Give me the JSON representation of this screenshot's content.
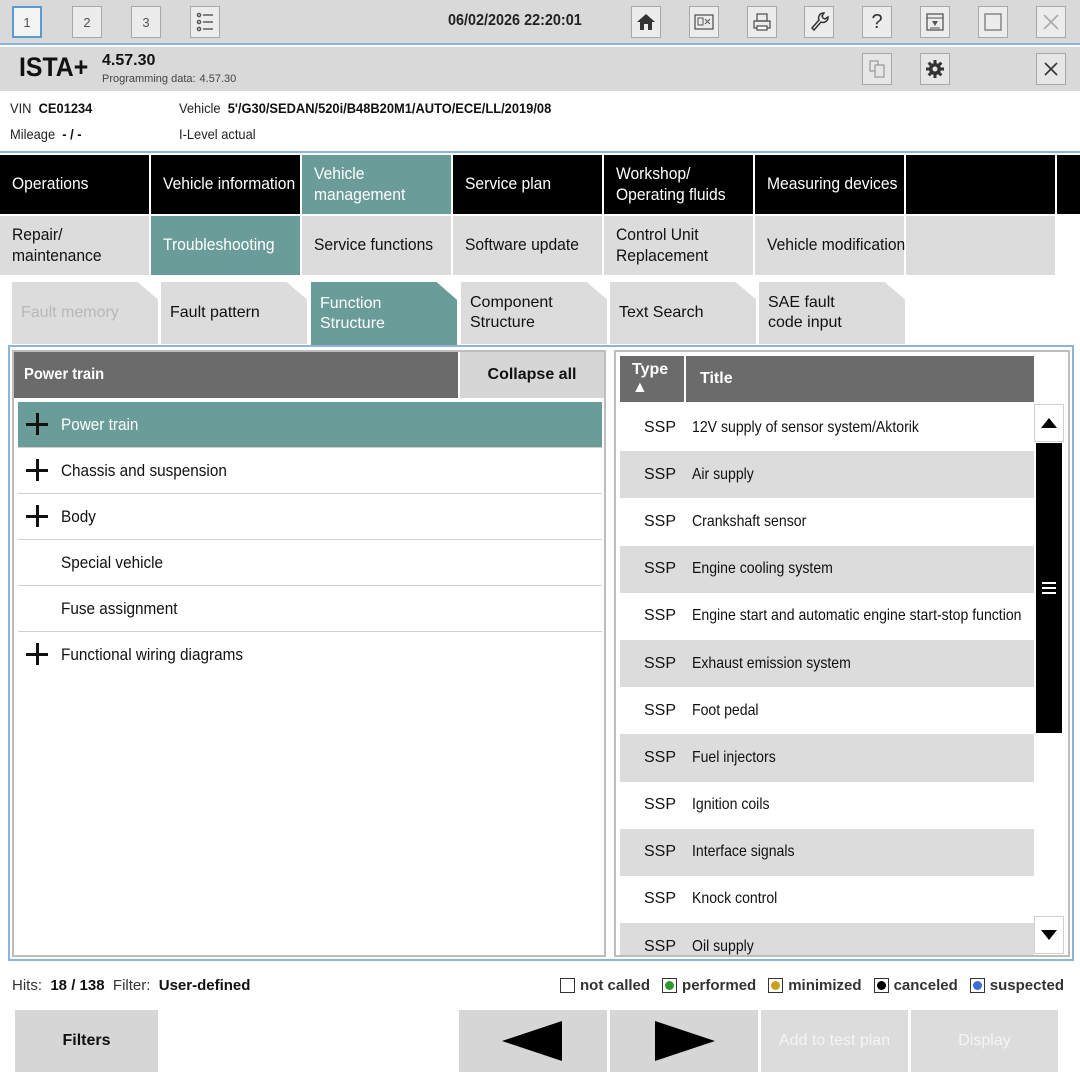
{
  "toolbar": {
    "tabs": [
      "1",
      "2",
      "3"
    ],
    "datetime": "06/02/2026 22:20:01",
    "icons": [
      "list-icon",
      "home-icon",
      "info-panel-icon",
      "print-icon",
      "wrench-icon",
      "help-icon",
      "download-icon",
      "window-icon",
      "close-icon"
    ],
    "help_glyph": "?"
  },
  "title": {
    "app": "ISTA+",
    "version": "4.57.30",
    "programming_label": "Programming data:",
    "programming_value": "4.57.30"
  },
  "vehicle": {
    "vin_label": "VIN",
    "vin": "CE01234",
    "vehicle_label": "Vehicle",
    "vehicle": "5'/G30/SEDAN/520i/B48B20M1/AUTO/ECE/LL/2019/08",
    "mileage_label": "Mileage",
    "mileage": "- / -",
    "ilevel": "I-Level actual"
  },
  "nav_main": [
    {
      "label": "Operations"
    },
    {
      "label": "Vehicle information"
    },
    {
      "label": "Vehicle management",
      "active": true
    },
    {
      "label": "Service plan"
    },
    {
      "label": "Workshop/ Operating fluids"
    },
    {
      "label": "Measuring devices"
    }
  ],
  "nav_sub": [
    {
      "label": "Repair/ maintenance"
    },
    {
      "label": "Troubleshooting",
      "active": true
    },
    {
      "label": "Service functions"
    },
    {
      "label": "Software update"
    },
    {
      "label": "Control Unit Replacement"
    },
    {
      "label": "Vehicle modification"
    }
  ],
  "nav_tabs": [
    {
      "label": "Fault memory",
      "disabled": true
    },
    {
      "label": "Fault pattern"
    },
    {
      "label": "Function Structure",
      "active": true
    },
    {
      "label": "Component Structure"
    },
    {
      "label": "Text Search"
    },
    {
      "label": "SAE fault code input"
    }
  ],
  "left_panel": {
    "title": "Power train",
    "collapse_label": "Collapse all",
    "tree": [
      {
        "label": "Power train",
        "expandable": true,
        "selected": true
      },
      {
        "label": "Chassis and suspension",
        "expandable": true
      },
      {
        "label": "Body",
        "expandable": true
      },
      {
        "label": "Special vehicle",
        "expandable": false
      },
      {
        "label": "Fuse assignment",
        "expandable": false
      },
      {
        "label": "Functional wiring diagrams",
        "expandable": true
      }
    ]
  },
  "right_panel": {
    "col_type": "Type ▲",
    "col_title": "Title",
    "rows": [
      {
        "type": "SSP",
        "title": "12V supply of sensor system/Aktorik"
      },
      {
        "type": "SSP",
        "title": "Air supply"
      },
      {
        "type": "SSP",
        "title": "Crankshaft sensor"
      },
      {
        "type": "SSP",
        "title": "Engine cooling system"
      },
      {
        "type": "SSP",
        "title": "Engine start and automatic engine start-stop function"
      },
      {
        "type": "SSP",
        "title": "Exhaust emission system"
      },
      {
        "type": "SSP",
        "title": "Foot pedal"
      },
      {
        "type": "SSP",
        "title": "Fuel injectors"
      },
      {
        "type": "SSP",
        "title": "Ignition coils"
      },
      {
        "type": "SSP",
        "title": "Interface signals"
      },
      {
        "type": "SSP",
        "title": "Knock control"
      },
      {
        "type": "SSP",
        "title": "Oil supply"
      }
    ]
  },
  "status": {
    "hits_label": "Hits:",
    "hits": "18 / 138",
    "filter_label": "Filter:",
    "filter": "User-defined",
    "legend": [
      {
        "label": "not called",
        "color": "#ffffff"
      },
      {
        "label": "performed",
        "color": "#2e9a2e"
      },
      {
        "label": "minimized",
        "color": "#c8a21a"
      },
      {
        "label": "canceled",
        "color": "#000000"
      },
      {
        "label": "suspected",
        "color": "#3a6fd8"
      }
    ]
  },
  "bottom": {
    "filters": "Filters",
    "add_to_test_plan": "Add to test plan",
    "display": "Display"
  },
  "colors": {
    "accent": "#6a9c9a",
    "header_gray": "#6b6b6b",
    "row_alt": "#dcdcdc",
    "frame_blue": "#8fb4d9"
  }
}
